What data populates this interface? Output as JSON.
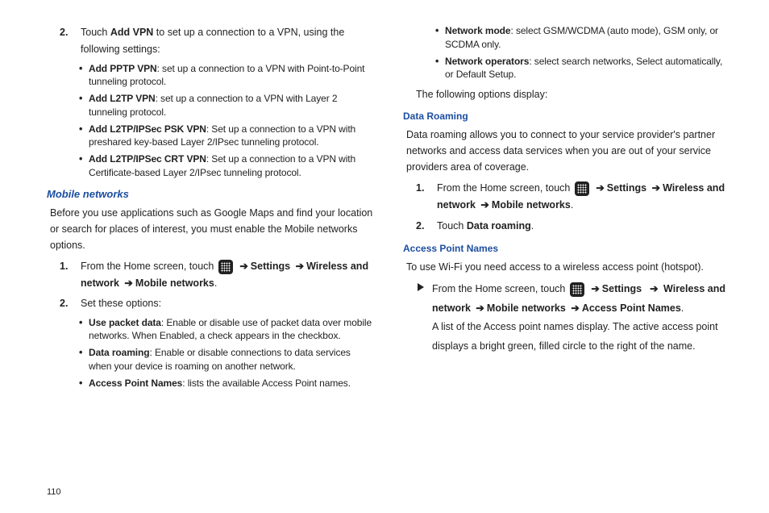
{
  "page_number": "110",
  "col1": {
    "step2": {
      "num": "2.",
      "pre": "Touch ",
      "bold": "Add VPN",
      "post": " to set up a connection to a VPN, using the following settings:"
    },
    "vpn_bullets": [
      {
        "bold": "Add PPTP VPN",
        "rest": ": set up a connection to a VPN with Point-to-Point tunneling protocol."
      },
      {
        "bold": "Add L2TP VPN",
        "rest": ": set up a connection to a VPN with Layer 2 tunneling protocol."
      },
      {
        "bold": "Add L2TP/IPSec PSK VPN",
        "rest": ": Set up a connection to a VPN with preshared key-based Layer 2/IPsec tunneling protocol."
      },
      {
        "bold": "Add L2TP/IPSec CRT VPN",
        "rest": ": Set up a connection to a VPN with Certificate-based Layer 2/IPsec tunneling protocol."
      }
    ],
    "mn_head": "Mobile networks",
    "mn_para": "Before you use applications such as Google Maps and find your location or search for places of interest, you must enable the Mobile networks options.",
    "mn_step1": {
      "num": "1.",
      "pre": "From the Home screen, touch ",
      "path": [
        {
          "bold": "Settings"
        },
        {
          "bold": "Wireless and network"
        },
        {
          "bold": "Mobile networks"
        }
      ]
    },
    "mn_step2": {
      "num": "2.",
      "text": "Set these options:"
    },
    "mn_bullets": [
      {
        "bold": "Use packet data",
        "rest": ": Enable or disable use of packet data over mobile networks. When Enabled, a check appears in the checkbox."
      },
      {
        "bold": "Data roaming",
        "rest": ": Enable or disable connections to data services when your device is roaming on another network."
      },
      {
        "bold": "Access Point Names",
        "rest": ": lists the available Access Point names."
      }
    ]
  },
  "col2": {
    "top_bullets": [
      {
        "bold": "Network mode",
        "rest": ": select GSM/WCDMA (auto mode), GSM only, or SCDMA only."
      },
      {
        "bold": "Network operators",
        "rest": ": select search networks, Select automatically, or Default Setup."
      }
    ],
    "follow_para": "The following options display:",
    "dr_head": "Data Roaming",
    "dr_para": "Data roaming allows you to connect to your service provider's partner networks and access data services when you are out of your service providers area of coverage.",
    "dr_step1": {
      "num": "1.",
      "pre": "From the Home screen, touch ",
      "path": [
        {
          "bold": "Settings"
        },
        {
          "bold": "Wireless and network"
        },
        {
          "bold": "Mobile networks"
        }
      ]
    },
    "dr_step2_num": "2.",
    "dr_step2_pre": "Touch ",
    "dr_step2_bold": "Data roaming",
    "dr_step2_post": ".",
    "apn_head": "Access Point Names",
    "apn_para": "To use Wi-Fi you need access to a wireless access point (hotspot).",
    "apn_tri": {
      "pre": "From the Home screen, touch ",
      "path": [
        {
          "bold": "Settings"
        },
        {
          "bold": "Wireless and network"
        },
        {
          "bold": "Mobile networks"
        },
        {
          "bold": "Access Point Names"
        }
      ],
      "post": ".",
      "after": "A list of the Access point names display. The active access point displays a bright green, filled circle to the right of the name."
    }
  }
}
